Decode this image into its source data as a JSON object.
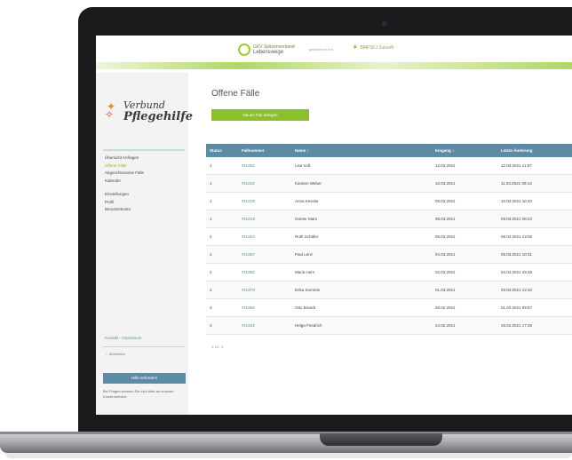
{
  "header": {
    "partner1_line1": "GKV Spitzenverband",
    "partner1_line2": "Lebenswege",
    "partner_caption": "gefördert durch",
    "partner2": "BMFSFJ Zukunft"
  },
  "sidebar": {
    "brand_line1": "Verbund",
    "brand_line2": "Pflegehilfe",
    "nav": [
      {
        "label": "Übersicht Anfragen",
        "active": false
      },
      {
        "label": "Offene Fälle",
        "active": true
      },
      {
        "label": "Abgeschlossene Fälle",
        "active": false
      },
      {
        "label": "Kalender",
        "active": false
      },
      {
        "label": "Einstellungen",
        "active": false
      },
      {
        "label": "Profil",
        "active": false
      },
      {
        "label": "Benutzerkonto",
        "active": false
      }
    ],
    "footer_link": "Kontakt · Impressum",
    "footer_small": "← Abmelden",
    "button_label": "Hilfe anfordern",
    "note": "Bei Fragen wenden Sie sich bitte an unseren Kundenservice."
  },
  "main": {
    "title": "Offene Fälle",
    "new_button": "Neuen Fall anlegen",
    "columns": [
      "Status",
      "Fallnummer",
      "Name ↕",
      "Eingang ↕",
      "Letzte Änderung"
    ],
    "rows": [
      {
        "status": "1",
        "id": "#10451",
        "name": "Lisa Voß",
        "date": "12.03.2021",
        "changed": "12.03.2021 11:57"
      },
      {
        "status": "1",
        "id": "#10432",
        "name": "Karsten Weber",
        "date": "10.03.2021",
        "changed": "11.03.2021 09:14"
      },
      {
        "status": "1",
        "id": "#10429",
        "name": "Anna Kessler",
        "date": "09.03.2021",
        "changed": "10.03.2021 16:40"
      },
      {
        "status": "1",
        "id": "#10418",
        "name": "Günter Marx",
        "date": "08.03.2021",
        "changed": "09.03.2021 08:22"
      },
      {
        "status": "2",
        "id": "#10404",
        "name": "Ruth Schäfer",
        "date": "05.03.2021",
        "changed": "08.03.2021 13:05"
      },
      {
        "status": "2",
        "id": "#10397",
        "name": "Paul Lenz",
        "date": "04.03.2021",
        "changed": "05.03.2021 10:31"
      },
      {
        "status": "2",
        "id": "#10381",
        "name": "Maria Horn",
        "date": "02.03.2021",
        "changed": "04.03.2021 15:48"
      },
      {
        "status": "2",
        "id": "#10370",
        "name": "Erika Sommer",
        "date": "01.03.2021",
        "changed": "03.03.2021 12:10"
      },
      {
        "status": "3",
        "id": "#10356",
        "name": "Otto Brandt",
        "date": "26.02.2021",
        "changed": "01.03.2021 09:57"
      },
      {
        "status": "3",
        "id": "#10342",
        "name": "Helga Friedrich",
        "date": "24.02.2021",
        "changed": "26.02.2021 17:26"
      }
    ],
    "pager": "1-10 · 1"
  },
  "colors": {
    "accent_green": "#8cbf2e",
    "header_blue": "#5b8ba5",
    "bezel": "#1b1b1d"
  }
}
